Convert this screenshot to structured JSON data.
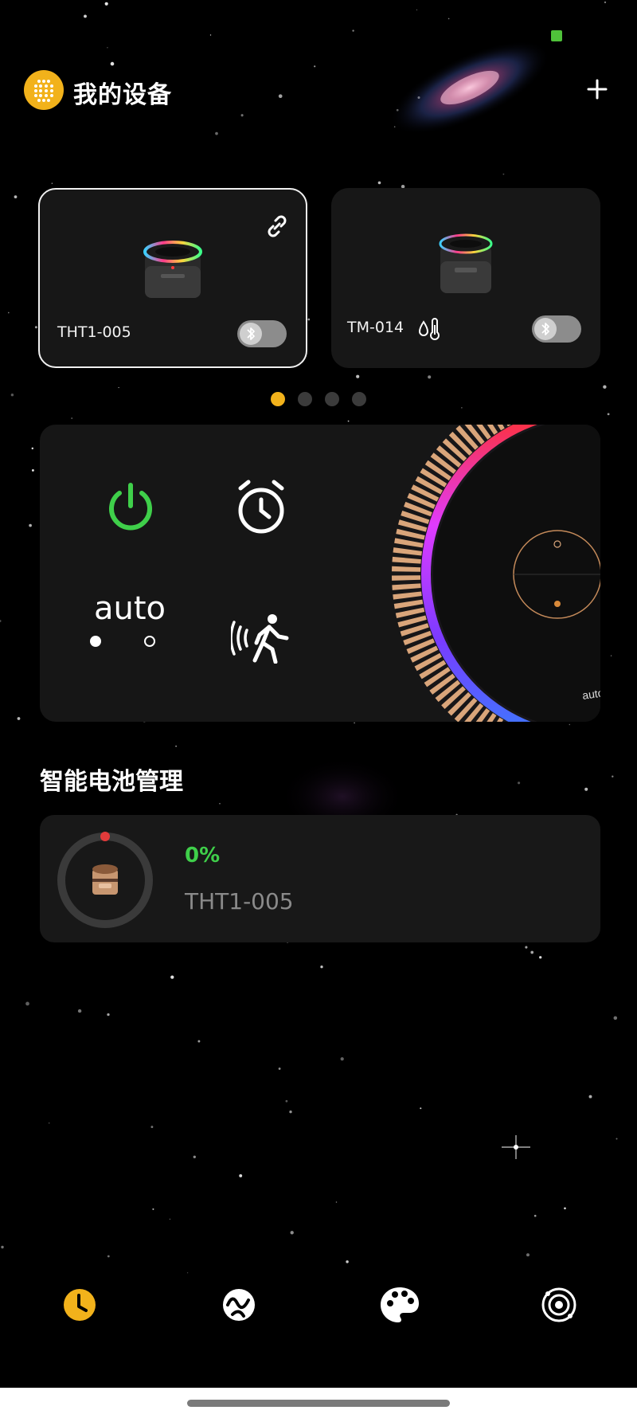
{
  "header": {
    "title": "我的设备",
    "logo_icon": "grid-dots-icon",
    "add_icon": "plus-icon"
  },
  "devices": [
    {
      "name": "THT1-005",
      "selected": true,
      "bluetooth_enabled": false,
      "icon": "link-icon"
    },
    {
      "name": "TM-014",
      "selected": false,
      "bluetooth_enabled": false,
      "icon": "thermometer-drop-icon"
    }
  ],
  "pager": {
    "count": 4,
    "active_index": 0
  },
  "controls": {
    "power_icon": "power-icon",
    "alarm_icon": "alarm-clock-icon",
    "auto_label": "auto",
    "motion_icon": "motion-sensor-icon",
    "preview_label": "auto"
  },
  "battery": {
    "section_title": "智能电池管理",
    "percent_text": "0%",
    "percent_value": 0,
    "device_name": "THT1-005"
  },
  "nav": [
    {
      "icon": "clock-icon",
      "active": true
    },
    {
      "icon": "effects-icon",
      "active": false
    },
    {
      "icon": "palette-icon",
      "active": false
    },
    {
      "icon": "orbit-icon",
      "active": false
    }
  ],
  "colors": {
    "accent": "#f2b21b",
    "power_green": "#3fcf4a",
    "card_bg": "#171717",
    "battery_low_dot": "#e23b3b"
  }
}
